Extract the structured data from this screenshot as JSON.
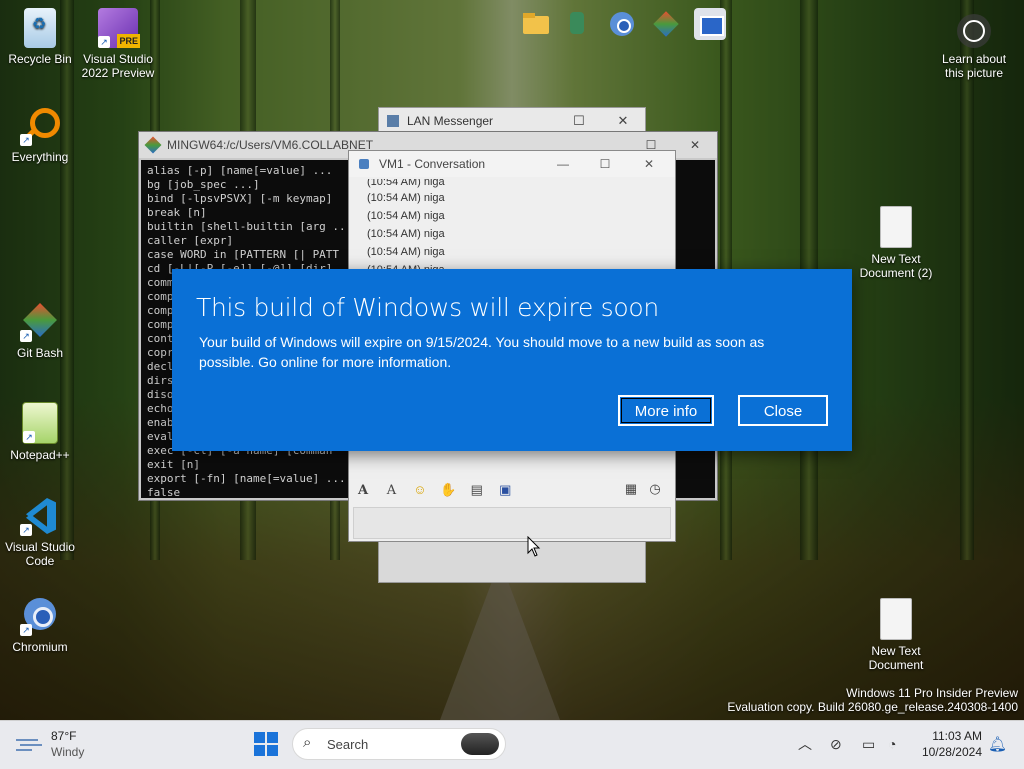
{
  "desktop": {
    "icons_left": [
      {
        "label": "Recycle Bin",
        "icon": "recycle-bin-icon"
      },
      {
        "label": "Visual Studio 2022 Preview",
        "icon": "visual-studio-icon",
        "badge": "PRE"
      },
      {
        "label": "Everything",
        "icon": "search-magnifier-icon"
      },
      {
        "label": "Git Bash",
        "icon": "git-icon"
      },
      {
        "label": "Notepad++",
        "icon": "notepad-icon"
      },
      {
        "label": "Visual Studio Code",
        "icon": "vscode-icon"
      },
      {
        "label": "Chromium",
        "icon": "chromium-icon"
      }
    ],
    "icons_right": [
      {
        "label": "Learn about this picture",
        "icon": "camera-icon"
      },
      {
        "label": "New Text Document (2)",
        "icon": "text-document-icon"
      },
      {
        "label": "New Text Document",
        "icon": "text-document-icon"
      }
    ],
    "watermark": {
      "line1": "Windows 11 Pro Insider Preview",
      "line2": "Evaluation copy. Build 26080.ge_release.240308-1400"
    }
  },
  "windows": {
    "lan_messenger": {
      "title": "LAN Messenger"
    },
    "terminal": {
      "title": "MINGW64:/c/Users/VM6.COLLABNET",
      "lines": [
        "alias [-p] [name[=value] ...",
        "bg [job_spec ...]",
        "bind [-lpsvPSVX] [-m keymap]",
        "break [n]",
        "builtin [shell-builtin [arg ...",
        "caller [expr]",
        "case WORD in [PATTERN [| PATT",
        "cd [-L|[-P [-e]] [-@]] [dir]",
        "comm",
        "comp",
        "comp",
        "comp",
        "cont",
        "copr",
        "decl",
        "dirs",
        "diso",
        "echo",
        "enab",
        "eval",
        "exec [-cl] [-a name] [comman",
        "exit [n]",
        "export [-fn] [name[=value] ...",
        "false"
      ]
    },
    "conversation": {
      "title": "VM1 - Conversation",
      "messages": [
        "(10:54 AM) niga",
        "(10:54 AM) niga",
        "(10:54 AM) niga",
        "(10:54 AM) niga",
        "(10:54 AM) niga",
        "(10:54 AM) niga"
      ]
    }
  },
  "toast": {
    "title": "This build of Windows will expire soon",
    "message": "Your build of Windows will expire on 9/15/2024. You should move to a new build as soon as possible. Go online for more information.",
    "more_info": "More info",
    "close": "Close"
  },
  "taskbar": {
    "weather_temp": "87°F",
    "weather_desc": "Windy",
    "search_placeholder": "Search",
    "time": "11:03 AM",
    "date": "10/28/2024"
  }
}
